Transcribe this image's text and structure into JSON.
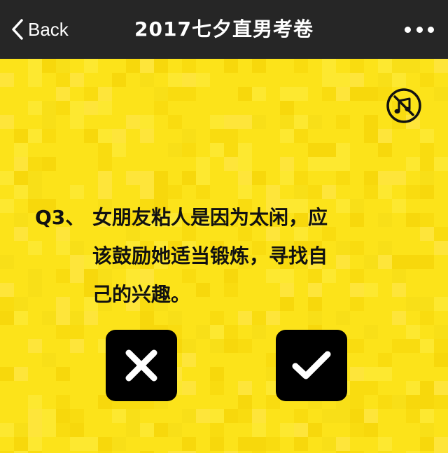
{
  "navbar": {
    "back_label": "Back",
    "title": "2017七夕直男考卷",
    "more_icon": "more-dots-icon"
  },
  "quiz": {
    "question_number": "Q3、",
    "question_lines": [
      "女朋友粘人是因为太闲，应",
      "该鼓励她适当锻炼，寻找自",
      "己的兴趣。"
    ],
    "false_icon": "cross-icon",
    "true_icon": "check-icon",
    "music_icon": "music-off-icon"
  },
  "colors": {
    "background_yellow": "#fce31a",
    "navbar_dark": "#262626",
    "button_black": "#000000"
  }
}
